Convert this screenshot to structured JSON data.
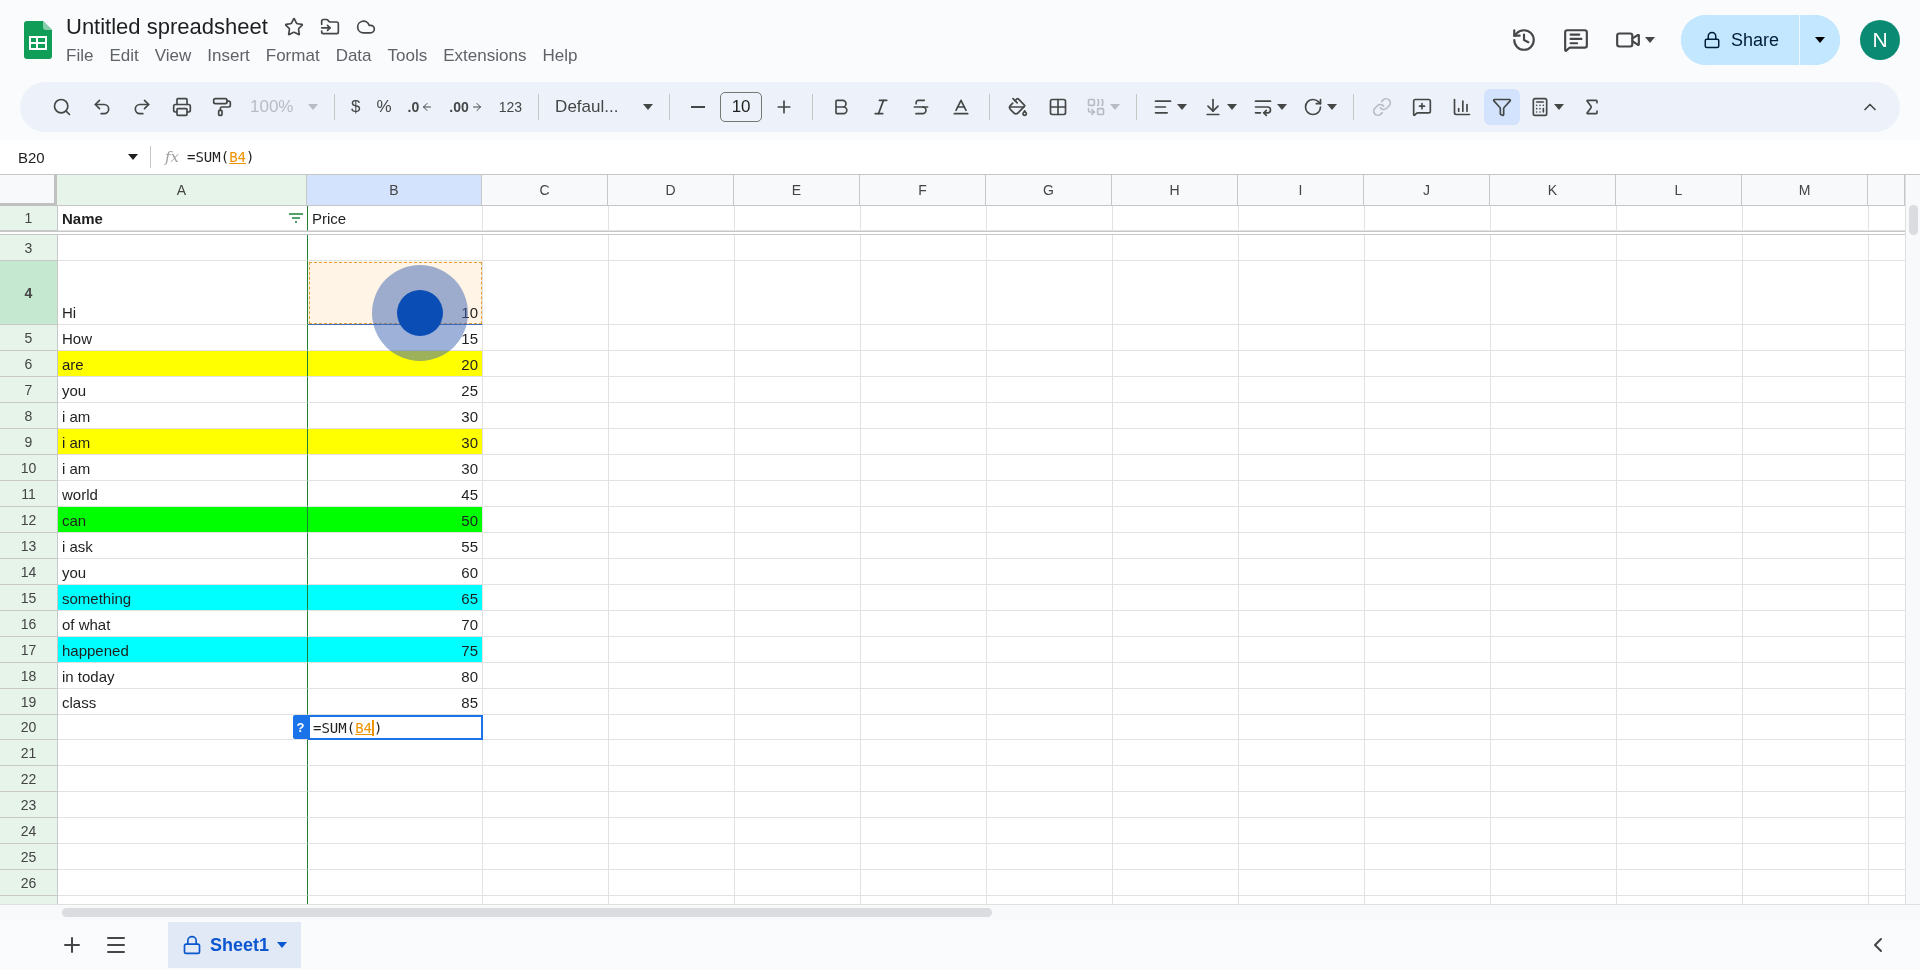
{
  "document": {
    "title": "Untitled spreadsheet"
  },
  "menu": [
    "File",
    "Edit",
    "View",
    "Insert",
    "Format",
    "Data",
    "Tools",
    "Extensions",
    "Help"
  ],
  "header": {
    "share": "Share",
    "avatar": "N"
  },
  "toolbar": {
    "zoom": {
      "label": "100%",
      "disabled": true
    },
    "currency": "$",
    "percent": "%",
    "decrease_decimal": ".0",
    "increase_decimal": ".00",
    "number_format": "123",
    "font": "Defaul...",
    "font_size": "10",
    "merge_disabled": true,
    "link_disabled": true,
    "filter_active": true
  },
  "formula_bar": {
    "name_box": "B20",
    "fx_label": "fx",
    "formula": {
      "prefix": "=SUM(",
      "reference": "B4",
      "suffix": ")"
    }
  },
  "columns": [
    {
      "label": "A",
      "selected": false,
      "filtered": true
    },
    {
      "label": "B",
      "selected": true,
      "filtered": false
    },
    {
      "label": "C",
      "selected": false,
      "filtered": false
    },
    {
      "label": "D",
      "selected": false,
      "filtered": false
    },
    {
      "label": "E",
      "selected": false,
      "filtered": false
    },
    {
      "label": "F",
      "selected": false,
      "filtered": false
    },
    {
      "label": "G",
      "selected": false,
      "filtered": false
    },
    {
      "label": "H",
      "selected": false,
      "filtered": false
    },
    {
      "label": "I",
      "selected": false,
      "filtered": false
    },
    {
      "label": "J",
      "selected": false,
      "filtered": false
    },
    {
      "label": "K",
      "selected": false,
      "filtered": false
    },
    {
      "label": "L",
      "selected": false,
      "filtered": false
    },
    {
      "label": "M",
      "selected": false,
      "filtered": false
    }
  ],
  "rows": [
    {
      "number": "1",
      "kind": "header",
      "name": "Name",
      "price": "Price",
      "selected": false
    },
    {
      "number": "3",
      "kind": "empty",
      "selected": false
    },
    {
      "number": "4",
      "kind": "tall",
      "name": "Hi",
      "price": "10",
      "selected": true,
      "referenced": true
    },
    {
      "number": "5",
      "kind": "data",
      "name": "How",
      "price": "15",
      "selected": false
    },
    {
      "number": "6",
      "kind": "data",
      "name": "are",
      "price": "20",
      "selected": false,
      "color": "#ffff00"
    },
    {
      "number": "7",
      "kind": "data",
      "name": "you",
      "price": "25",
      "selected": false
    },
    {
      "number": "8",
      "kind": "data",
      "name": "i am",
      "price": "30",
      "selected": false
    },
    {
      "number": "9",
      "kind": "data",
      "name": "i am",
      "price": "30",
      "selected": false,
      "color": "#ffff00"
    },
    {
      "number": "10",
      "kind": "data",
      "name": "i am",
      "price": "30",
      "selected": false
    },
    {
      "number": "11",
      "kind": "data",
      "name": "world",
      "price": "45",
      "selected": false
    },
    {
      "number": "12",
      "kind": "data",
      "name": "can",
      "price": "50",
      "selected": false,
      "color": "#00ff00"
    },
    {
      "number": "13",
      "kind": "data",
      "name": "i ask",
      "price": "55",
      "selected": false
    },
    {
      "number": "14",
      "kind": "data",
      "name": "you",
      "price": "60",
      "selected": false
    },
    {
      "number": "15",
      "kind": "data",
      "name": "something",
      "price": "65",
      "selected": false,
      "color": "#00ffff"
    },
    {
      "number": "16",
      "kind": "data",
      "name": "of what",
      "price": "70",
      "selected": false
    },
    {
      "number": "17",
      "kind": "data",
      "name": "happened",
      "price": "75",
      "selected": false,
      "color": "#00ffff"
    },
    {
      "number": "18",
      "kind": "data",
      "name": "in today",
      "price": "80",
      "selected": false
    },
    {
      "number": "19",
      "kind": "data",
      "name": "class",
      "price": "85",
      "selected": false
    },
    {
      "number": "20",
      "kind": "editing",
      "selected": false,
      "help": "?",
      "formula": {
        "prefix": "=SUM(",
        "reference": "B4",
        "suffix": ")"
      }
    },
    {
      "number": "21",
      "kind": "empty",
      "selected": false
    },
    {
      "number": "22",
      "kind": "empty",
      "selected": false
    },
    {
      "number": "23",
      "kind": "empty",
      "selected": false
    },
    {
      "number": "24",
      "kind": "empty",
      "selected": false
    },
    {
      "number": "25",
      "kind": "empty",
      "selected": false
    },
    {
      "number": "26",
      "kind": "empty",
      "selected": false
    }
  ],
  "sheet_tabs": [
    {
      "label": "Sheet1",
      "selected": true
    }
  ]
}
